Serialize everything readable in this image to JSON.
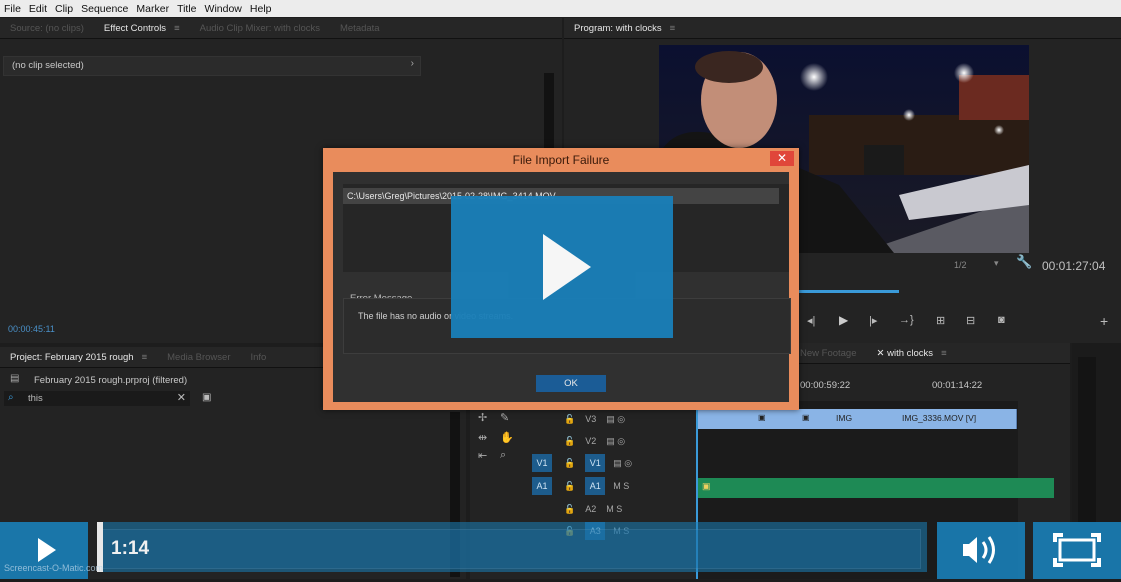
{
  "menu": [
    "File",
    "Edit",
    "Clip",
    "Sequence",
    "Marker",
    "Title",
    "Window",
    "Help"
  ],
  "left_panel": {
    "tabs": [
      "Source: (no clips)",
      "Effect Controls",
      "Audio Clip Mixer: with clocks",
      "Metadata"
    ],
    "status": "(no clip selected)",
    "timecode": "00:00:45:11"
  },
  "program": {
    "tab": "Program: with clocks",
    "zoom": "1/2",
    "timecode": "00:01:27:04"
  },
  "project": {
    "tabs": [
      "Project: February 2015 rough",
      "Media Browser",
      "Info"
    ],
    "file": "February 2015 rough.prproj (filtered)",
    "search_value": "this"
  },
  "timeline": {
    "tabs": [
      "New Footage",
      "with clocks"
    ],
    "ruler": [
      "00:00:59:22",
      "00:01:14:22"
    ],
    "tracks": [
      {
        "name": "V3",
        "sub": ""
      },
      {
        "name": "V2",
        "sub": ""
      },
      {
        "name": "V1",
        "src": "V1",
        "sub": ""
      },
      {
        "name": "A1",
        "src": "A1",
        "sub": "M   S"
      },
      {
        "name": "A2",
        "sub": "M   S"
      },
      {
        "name": "A3",
        "sub": "M   S"
      }
    ],
    "clip_labels": [
      "IMG",
      "IMG_3336.MOV [V]"
    ]
  },
  "dialog": {
    "title": "File Import Failure",
    "path": "C:\\Users\\Greg\\Pictures\\2015-02-28\\IMG_3414.MOV",
    "error_label": "Error Message",
    "error_text": "The file has no audio or video streams.",
    "ok": "OK",
    "close": "✕"
  },
  "player": {
    "time": "1:14",
    "watermark": "Screencast-O-Matic.com"
  }
}
